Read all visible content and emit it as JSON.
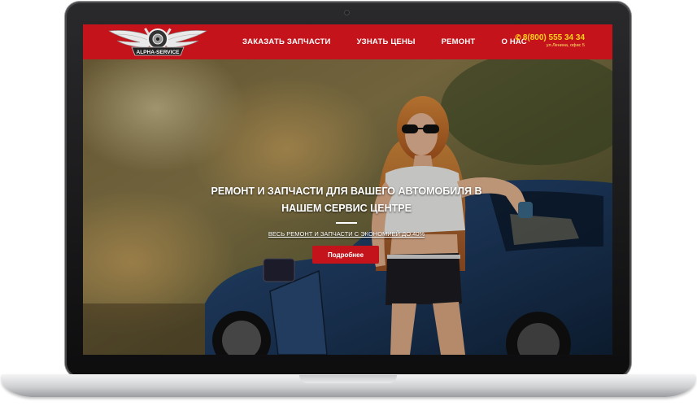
{
  "header": {
    "logo_text": "ALPHA-SERVICE",
    "nav": [
      {
        "label": "ЗАКАЗАТЬ ЗАПЧАСТИ"
      },
      {
        "label": "УЗНАТЬ ЦЕНЫ"
      },
      {
        "label": "РЕМОНТ"
      },
      {
        "label": "О НАС"
      }
    ],
    "phone": "8(800) 555 34 34",
    "address": "ул.Ленина, офис 5"
  },
  "hero": {
    "title": "РЕМОНТ И ЗАПЧАСТИ ДЛЯ ВАШЕГО АВТОМОБИЛЯ В НАШЕМ СЕРВИС ЦЕНТРЕ",
    "subtitle": "ВЕСЬ РЕМОНТ И ЗАПЧАСТИ С ЭКОНОМИЕЙ ДО 40%",
    "button": "Подробнее"
  },
  "colors": {
    "brand_red": "#c4131b",
    "phone_yellow": "#ffd21a"
  },
  "icons": {
    "phone": "phone-icon",
    "logo": "winged-wheel-logo"
  }
}
